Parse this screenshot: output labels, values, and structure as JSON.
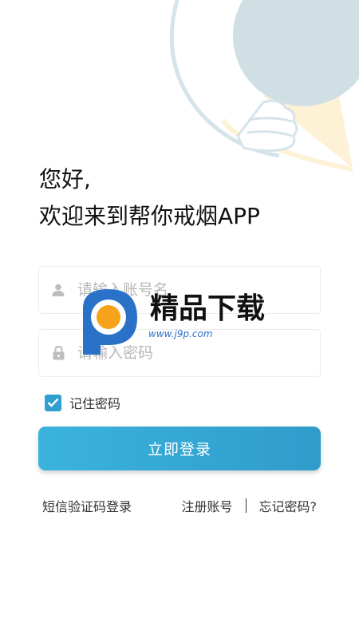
{
  "greeting": {
    "line1": "您好,",
    "line2": "欢迎来到帮你戒烟APP"
  },
  "form": {
    "username_placeholder": "请输入账号名",
    "password_placeholder": "请输入密码",
    "remember_label": "记住密码",
    "remember_checked": true
  },
  "login_button": "立即登录",
  "links": {
    "sms_login": "短信验证码登录",
    "register": "注册账号",
    "forgot_password": "忘记密码?"
  },
  "watermark": {
    "text": "精品下载",
    "url": "www.j9p.com"
  },
  "icons": {
    "username": "user-icon",
    "password": "lock-icon",
    "checkbox": "check-icon",
    "wifi": "wifi-icon",
    "battery": "battery-icon"
  },
  "colors": {
    "accent": "#2f9fcf",
    "illustration_circle": "#cfdfe4",
    "illustration_yellow": "#fdf1d6"
  }
}
